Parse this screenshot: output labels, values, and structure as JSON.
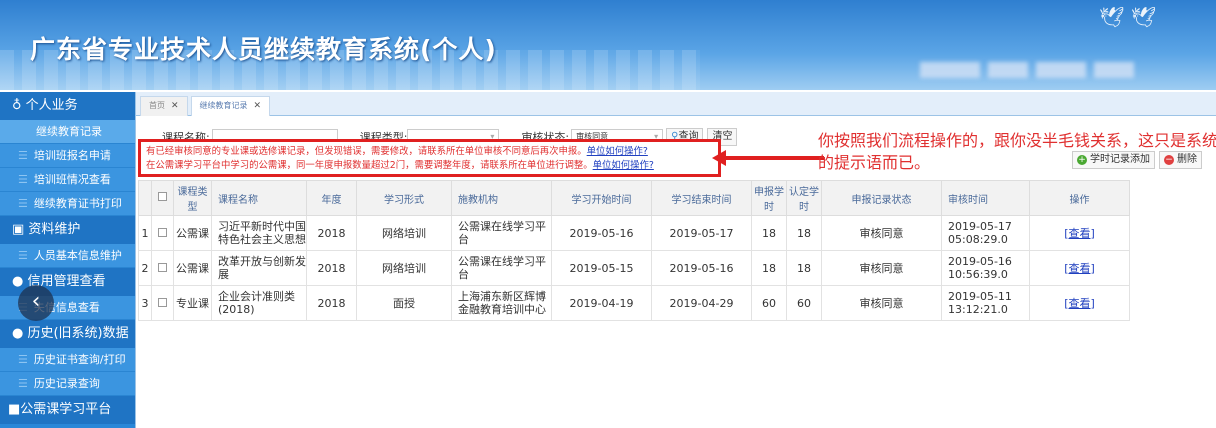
{
  "header": {
    "title": "广东省专业技术人员继续教育系统(个人)"
  },
  "sidebar": {
    "groups": [
      {
        "label": "个人业务",
        "icon": "person-icon",
        "items": [
          "继续教育记录",
          "培训班报名申请",
          "培训班情况查看",
          "继续教育证书打印"
        ]
      },
      {
        "label": "资料维护",
        "icon": "card-icon",
        "items": [
          "人员基本信息维护"
        ]
      },
      {
        "label": "信用管理查看",
        "icon": "pin-icon",
        "items": [
          "失信信息查看"
        ]
      },
      {
        "label": "历史(旧系统)数据",
        "icon": "pin-icon",
        "items": [
          "历史证书查询/打印",
          "历史记录查询"
        ]
      },
      {
        "label": "公需课学习平台",
        "icon": "square-icon",
        "items": []
      }
    ]
  },
  "tabs": [
    {
      "label": "首页"
    },
    {
      "label": "继续教育记录"
    }
  ],
  "search": {
    "course_name_label": "课程名称:",
    "course_name_value": "",
    "course_type_label": "课程类型:",
    "course_type_value": "",
    "status_label": "审核状态:",
    "status_value": "审核同意",
    "query": "查询",
    "clear": "清空"
  },
  "notice": {
    "line1": "有已经审核同意的专业课或选修课记录，但发现错误，需要修改，请联系所在单位审核不同意后再次申报。",
    "line2": "在公需课学习平台中学习的公需课，同一年度申报数量超过2门，需要调整年度，请联系所在单位进行调整。",
    "link": "单位如何操作?"
  },
  "annotation": "你按照我们流程操作的，跟你没半毛钱关系，这只是系统的提示语而已。",
  "actions": {
    "add": "学时记录添加",
    "delete": "删除"
  },
  "table": {
    "headers": [
      "课程类型",
      "课程名称",
      "年度",
      "学习形式",
      "施教机构",
      "学习开始时间",
      "学习结束时间",
      "申报学时",
      "认定学时",
      "申报记录状态",
      "审核时间",
      "操作"
    ],
    "rows": [
      {
        "n": "1",
        "type": "公需课",
        "name": "习近平新时代中国特色社会主义思想",
        "year": "2018",
        "form": "网络培训",
        "org": "公需课在线学习平台",
        "start": "2019-05-16",
        "end": "2019-05-17",
        "hours": "18",
        "approved": "18",
        "status": "审核同意",
        "time": "2019-05-17 05:08:29.0",
        "op": "[查看]"
      },
      {
        "n": "2",
        "type": "公需课",
        "name": "改革开放与创新发展",
        "year": "2018",
        "form": "网络培训",
        "org": "公需课在线学习平台",
        "start": "2019-05-15",
        "end": "2019-05-16",
        "hours": "18",
        "approved": "18",
        "status": "审核同意",
        "time": "2019-05-16 10:56:39.0",
        "op": "[查看]"
      },
      {
        "n": "3",
        "type": "专业课",
        "name": "企业会计准则类(2018)",
        "year": "2018",
        "form": "面授",
        "org": "上海浦东新区辉博金融教育培训中心",
        "start": "2019-04-19",
        "end": "2019-04-29",
        "hours": "60",
        "approved": "60",
        "status": "审核同意",
        "time": "2019-05-11 13:12:21.0",
        "op": "[查看]"
      }
    ]
  }
}
